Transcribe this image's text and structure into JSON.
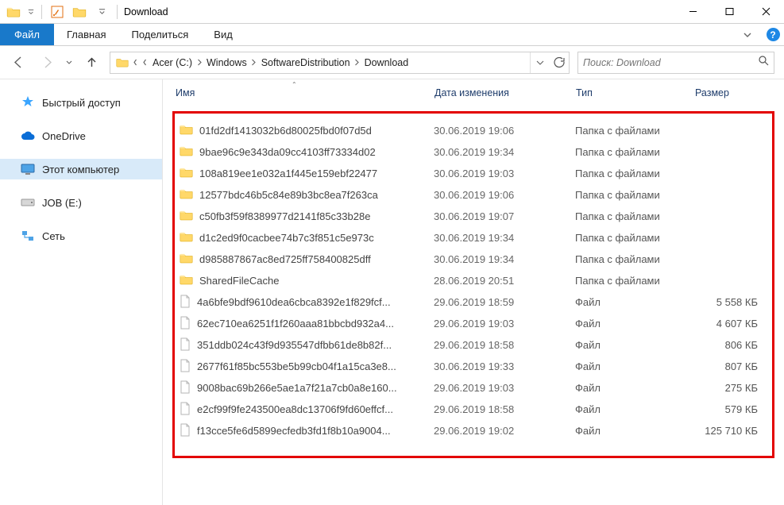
{
  "window": {
    "title": "Download"
  },
  "ribbon": {
    "file": "Файл",
    "tabs": [
      "Главная",
      "Поделиться",
      "Вид"
    ]
  },
  "breadcrumbs": [
    "Acer (C:)",
    "Windows",
    "SoftwareDistribution",
    "Download"
  ],
  "search": {
    "placeholder": "Поиск: Download"
  },
  "nav": {
    "quick": "Быстрый доступ",
    "onedrive": "OneDrive",
    "thispc": "Этот компьютер",
    "job": "JOB (E:)",
    "network": "Сеть"
  },
  "columns": {
    "name": "Имя",
    "date": "Дата изменения",
    "type": "Тип",
    "size": "Размер"
  },
  "types": {
    "folder": "Папка с файлами",
    "file": "Файл"
  },
  "items": [
    {
      "kind": "folder",
      "name": "01fd2df1413032b6d80025fbd0f07d5d",
      "date": "30.06.2019 19:06",
      "type": "Папка с файлами",
      "size": ""
    },
    {
      "kind": "folder",
      "name": "9bae96c9e343da09cc4103ff73334d02",
      "date": "30.06.2019 19:34",
      "type": "Папка с файлами",
      "size": ""
    },
    {
      "kind": "folder",
      "name": "108a819ee1e032a1f445e159ebf22477",
      "date": "30.06.2019 19:03",
      "type": "Папка с файлами",
      "size": ""
    },
    {
      "kind": "folder",
      "name": "12577bdc46b5c84e89b3bc8ea7f263ca",
      "date": "30.06.2019 19:06",
      "type": "Папка с файлами",
      "size": ""
    },
    {
      "kind": "folder",
      "name": "c50fb3f59f8389977d2141f85c33b28e",
      "date": "30.06.2019 19:07",
      "type": "Папка с файлами",
      "size": ""
    },
    {
      "kind": "folder",
      "name": "d1c2ed9f0cacbee74b7c3f851c5e973c",
      "date": "30.06.2019 19:34",
      "type": "Папка с файлами",
      "size": ""
    },
    {
      "kind": "folder",
      "name": "d985887867ac8ed725ff758400825dff",
      "date": "30.06.2019 19:34",
      "type": "Папка с файлами",
      "size": ""
    },
    {
      "kind": "folder",
      "name": "SharedFileCache",
      "date": "28.06.2019 20:51",
      "type": "Папка с файлами",
      "size": ""
    },
    {
      "kind": "file",
      "name": "4a6bfe9bdf9610dea6cbca8392e1f829fcf...",
      "date": "29.06.2019 18:59",
      "type": "Файл",
      "size": "5 558 КБ"
    },
    {
      "kind": "file",
      "name": "62ec710ea6251f1f260aaa81bbcbd932a4...",
      "date": "29.06.2019 19:03",
      "type": "Файл",
      "size": "4 607 КБ"
    },
    {
      "kind": "file",
      "name": "351ddb024c43f9d935547dfbb61de8b82f...",
      "date": "29.06.2019 18:58",
      "type": "Файл",
      "size": "806 КБ"
    },
    {
      "kind": "file",
      "name": "2677f61f85bc553be5b99cb04f1a15ca3e8...",
      "date": "30.06.2019 19:33",
      "type": "Файл",
      "size": "807 КБ"
    },
    {
      "kind": "file",
      "name": "9008bac69b266e5ae1a7f21a7cb0a8e160...",
      "date": "29.06.2019 19:03",
      "type": "Файл",
      "size": "275 КБ"
    },
    {
      "kind": "file",
      "name": "e2cf99f9fe243500ea8dc13706f9fd60effcf...",
      "date": "29.06.2019 18:58",
      "type": "Файл",
      "size": "579 КБ"
    },
    {
      "kind": "file",
      "name": "f13cce5fe6d5899ecfedb3fd1f8b10a9004...",
      "date": "29.06.2019 19:02",
      "type": "Файл",
      "size": "125 710 КБ"
    }
  ]
}
